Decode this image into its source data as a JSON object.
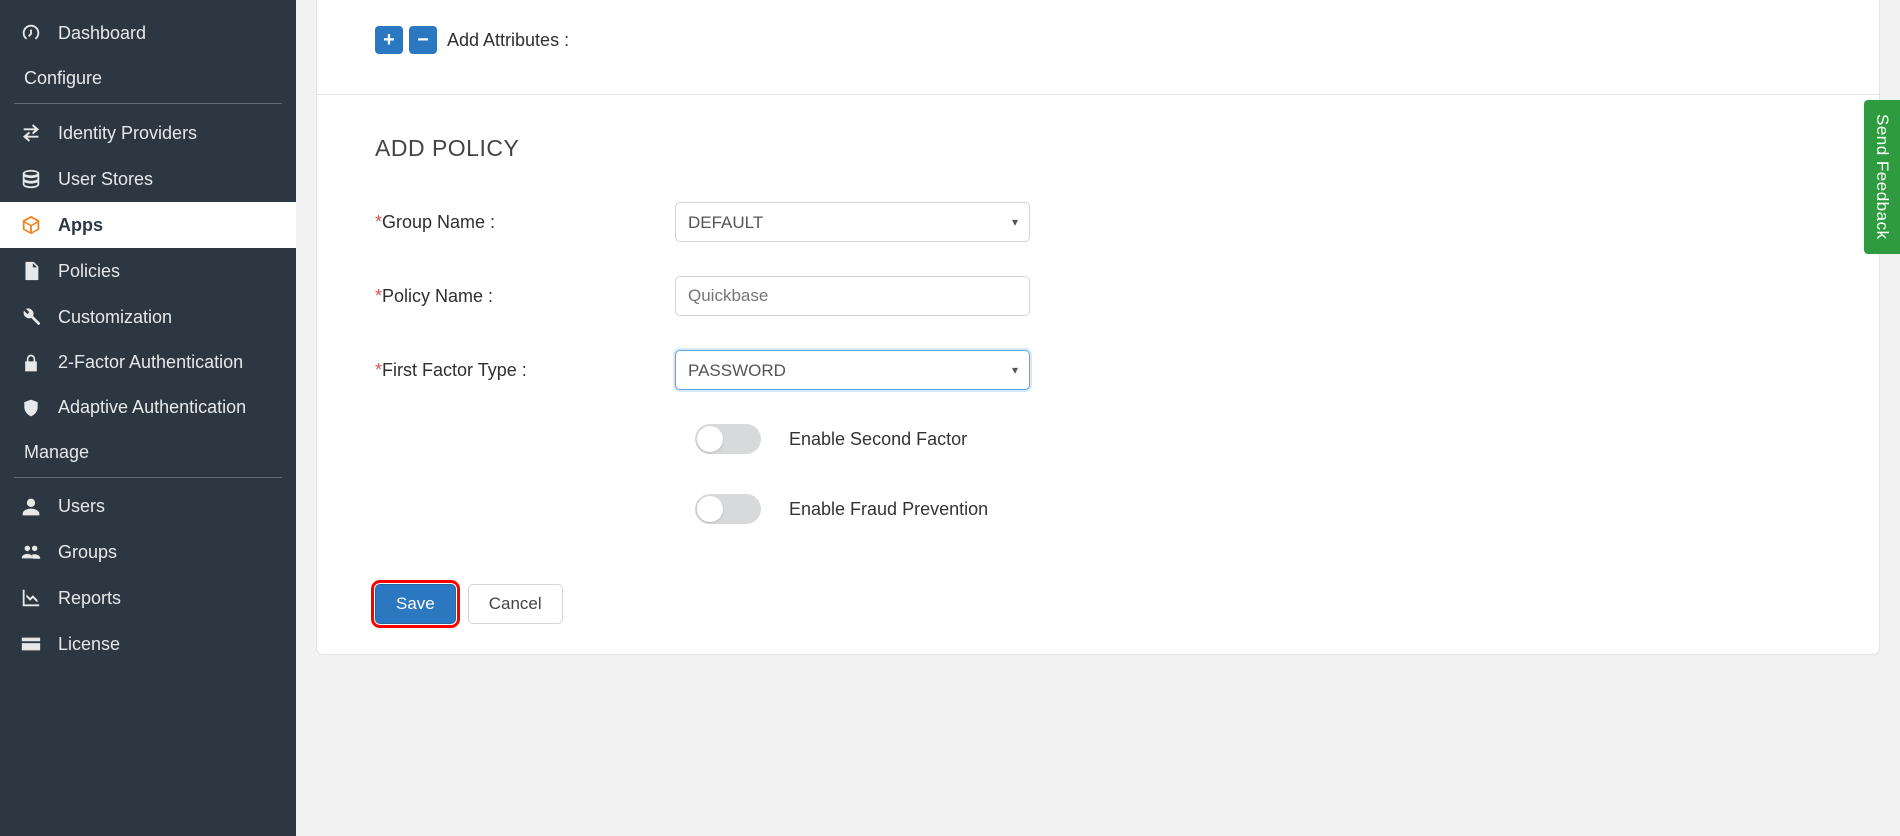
{
  "sidebar": {
    "dashboard": "Dashboard",
    "sections": {
      "configure": "Configure",
      "manage": "Manage"
    },
    "items": {
      "identity_providers": "Identity Providers",
      "user_stores": "User Stores",
      "apps": "Apps",
      "policies": "Policies",
      "customization": "Customization",
      "two_factor": "2-Factor Authentication",
      "adaptive_auth": "Adaptive Authentication",
      "users": "Users",
      "groups": "Groups",
      "reports": "Reports",
      "license": "License"
    }
  },
  "attributes": {
    "add_label": "Add Attributes :"
  },
  "policy": {
    "title": "ADD POLICY",
    "labels": {
      "group_name": "Group Name :",
      "policy_name": "Policy Name :",
      "first_factor": "First Factor Type :",
      "enable_second_factor": "Enable Second Factor",
      "enable_fraud_prevention": "Enable Fraud Prevention"
    },
    "values": {
      "group_name": "DEFAULT",
      "policy_name_placeholder": "Quickbase",
      "first_factor": "PASSWORD"
    }
  },
  "buttons": {
    "save": "Save",
    "cancel": "Cancel"
  },
  "feedback": "Send Feedback"
}
